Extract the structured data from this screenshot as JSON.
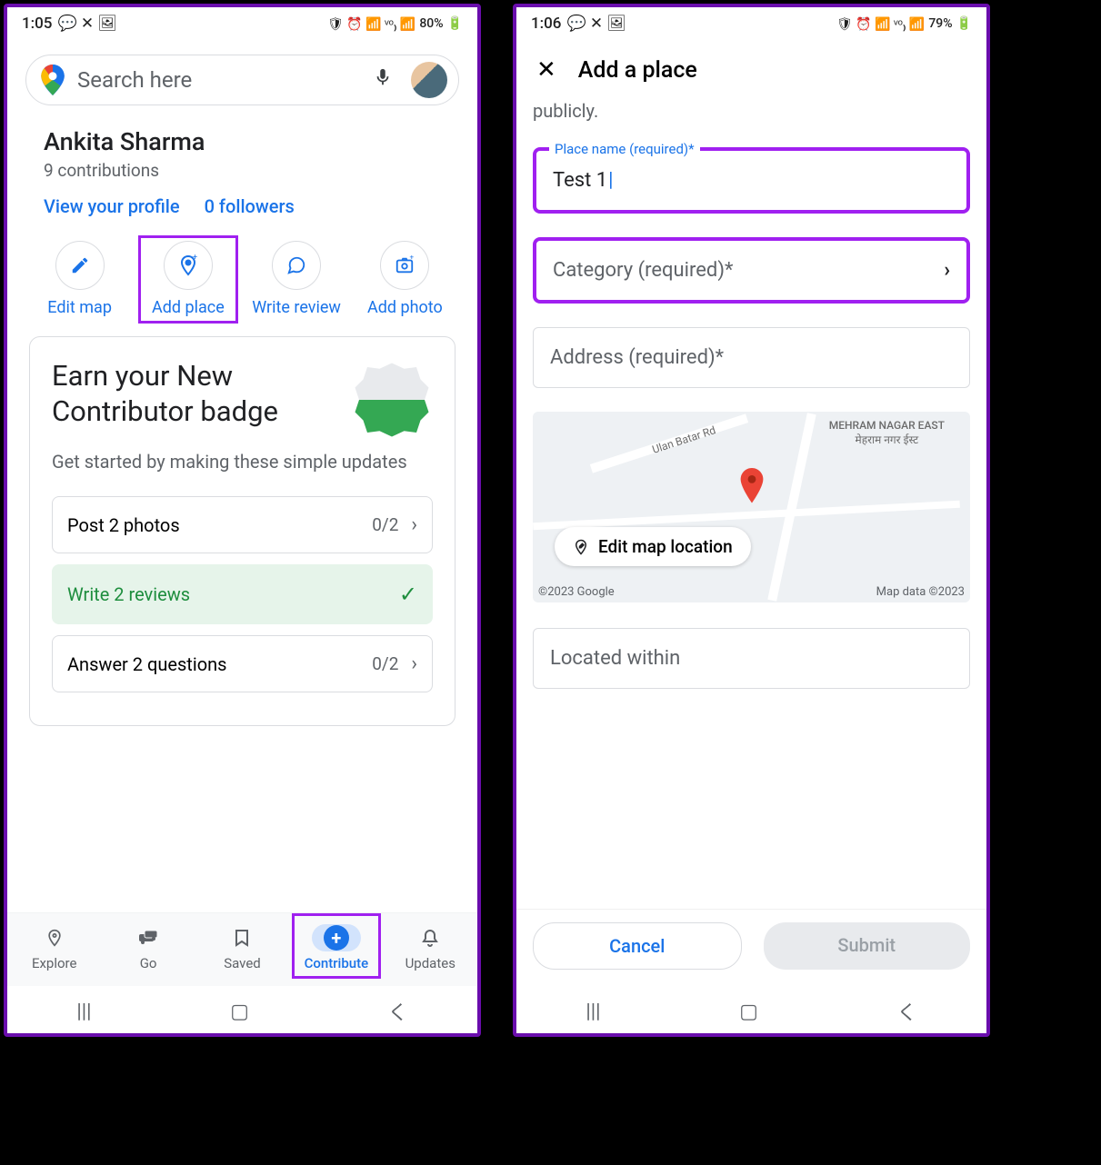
{
  "phone1": {
    "status": {
      "time": "1:05",
      "battery": "80%"
    },
    "search": {
      "placeholder": "Search here"
    },
    "profile": {
      "name": "Ankita Sharma",
      "contributions": "9 contributions",
      "view_profile": "View your profile",
      "followers": "0 followers"
    },
    "actions": {
      "edit_map": "Edit map",
      "add_place": "Add place",
      "write_review": "Write review",
      "add_photo": "Add photo"
    },
    "badge": {
      "title": "Earn your New Contributor badge",
      "subtitle": "Get started by making these simple updates",
      "tasks": {
        "photos": {
          "label": "Post 2 photos",
          "count": "0/2"
        },
        "reviews": {
          "label": "Write 2 reviews"
        },
        "questions": {
          "label": "Answer 2 questions",
          "count": "0/2"
        }
      }
    },
    "nav": {
      "explore": "Explore",
      "go": "Go",
      "saved": "Saved",
      "contribute": "Contribute",
      "updates": "Updates"
    }
  },
  "phone2": {
    "status": {
      "time": "1:06",
      "battery": "79%"
    },
    "header": {
      "title": "Add a place"
    },
    "hint": "publicly.",
    "fields": {
      "place_name": {
        "label": "Place name (required)*",
        "value": "Test 1"
      },
      "category": {
        "placeholder": "Category (required)*"
      },
      "address": {
        "placeholder": "Address (required)*"
      },
      "located": {
        "placeholder": "Located within"
      }
    },
    "map": {
      "edit_label": "Edit map location",
      "road1": "Ulan Batar Rd",
      "area": "MEHRAM NAGAR EAST",
      "area_hi": "मेहराम नगर ईस्ट",
      "copyright": "©2023 Google",
      "attribution": "Map data ©2023"
    },
    "buttons": {
      "cancel": "Cancel",
      "submit": "Submit"
    }
  }
}
